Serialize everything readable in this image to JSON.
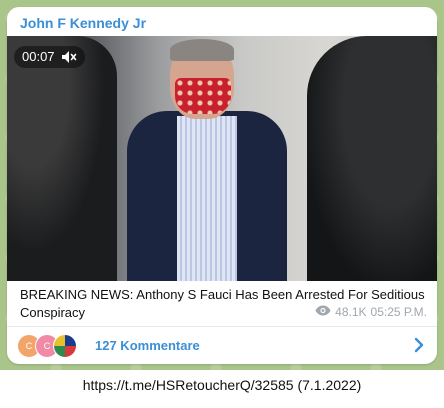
{
  "channel": {
    "name": "John F Kennedy Jr"
  },
  "video": {
    "duration": "00:07",
    "muted": true,
    "mute_icon": "speaker-muted-icon"
  },
  "post": {
    "text": "BREAKING NEWS: Anthony S Fauci Has Been Arrested For Seditious Conspiracy",
    "views": "48.1K",
    "time": "05:25 P.M.",
    "views_icon": "eye-icon"
  },
  "comments": {
    "label": "127 Kommentare",
    "avatars": [
      "C",
      "C",
      ""
    ],
    "chevron_icon": "chevron-right-icon"
  },
  "source_caption": "https://t.me/HSRetoucherQ/32585 (7.1.2022)",
  "colors": {
    "accent": "#3a8fd6",
    "chat_background": "#a9c58a",
    "meta": "#a0a7ae"
  }
}
